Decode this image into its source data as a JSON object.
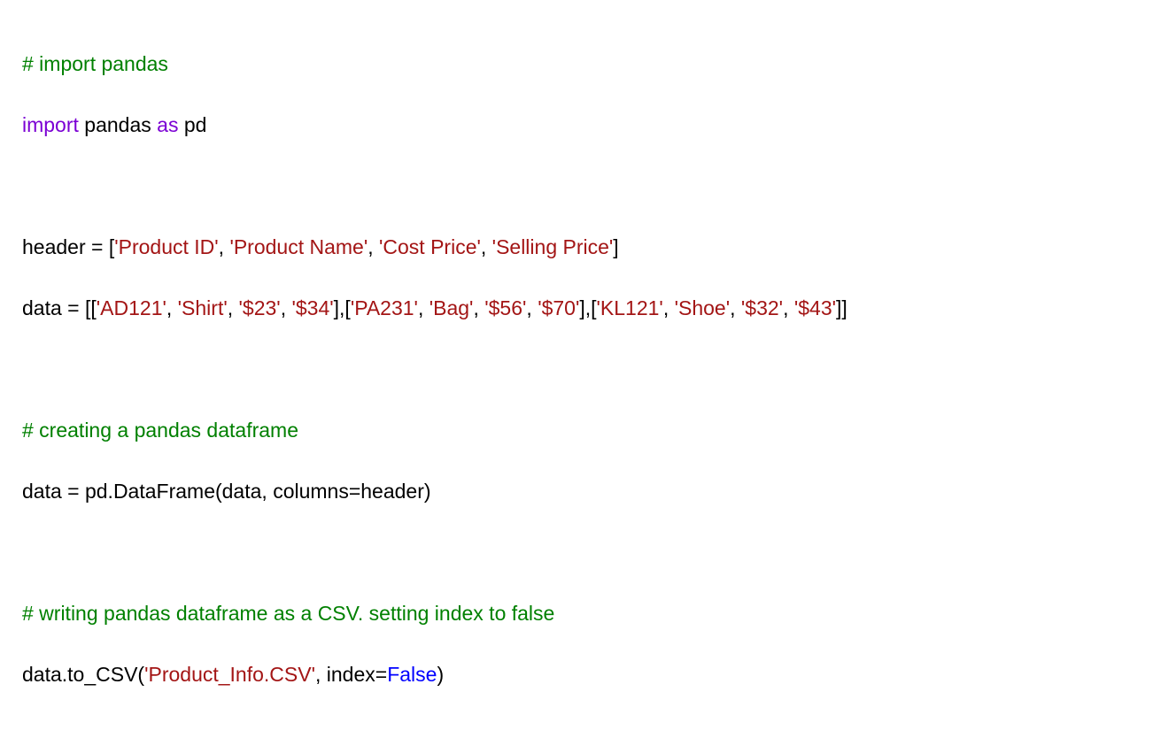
{
  "code": {
    "line1": {
      "comment": "# import pandas"
    },
    "line2": {
      "kw_import": "import",
      "pandas": " pandas ",
      "kw_as": "as",
      "alias": " pd"
    },
    "line3": {
      "header_assign": "header = [",
      "h1": "'Product ID'",
      "c1": ", ",
      "h2": "'Product Name'",
      "c2": ", ",
      "h3": "'Cost Price'",
      "c3": ", ",
      "h4": "'Selling Price'",
      "close": "]"
    },
    "line4": {
      "data_assign": "data = [[",
      "r1c1": "'AD121'",
      "s1": ", ",
      "r1c2": "'Shirt'",
      "s2": ", ",
      "r1c3": "'$23'",
      "s3": ", ",
      "r1c4": "'$34'",
      "mid1": "],[",
      "r2c1": "'PA231'",
      "s4": ", ",
      "r2c2": "'Bag'",
      "s5": ", ",
      "r2c3": "'$56'",
      "s6": ", ",
      "r2c4": "'$70'",
      "mid2": "],[",
      "r3c1": "'KL121'",
      "s7": ", ",
      "r3c2": "'Shoe'",
      "s8": ", ",
      "r3c3": "'$32'",
      "s9": ", ",
      "r3c4": "'$43'",
      "close": "]]"
    },
    "line5": {
      "comment": "# creating a pandas dataframe"
    },
    "line6": {
      "text": "data = pd.DataFrame(data, columns=header)"
    },
    "line7": {
      "comment": "# writing pandas dataframe as a CSV. setting index to false"
    },
    "line8": {
      "pre": "data.to_CSV(",
      "fname": "'Product_Info.CSV'",
      "mid": ", index=",
      "bool": "False",
      "close": ")"
    }
  }
}
